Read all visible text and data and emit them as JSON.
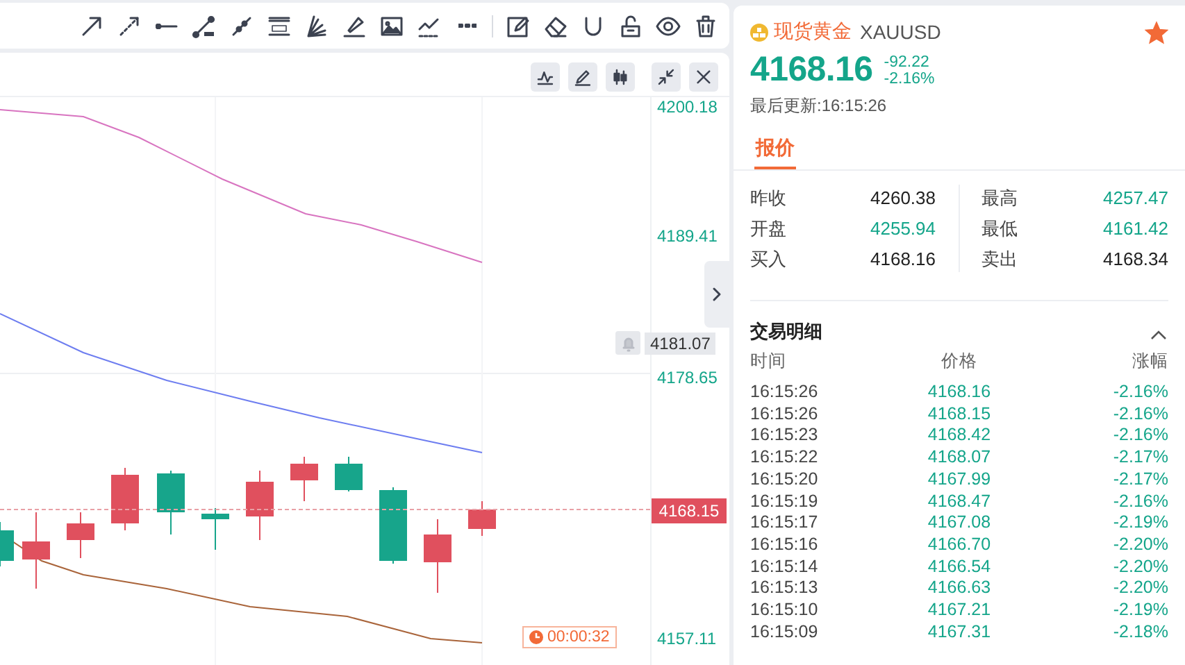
{
  "chart": {
    "header_buttons": [
      {
        "kind": "indicator"
      },
      {
        "kind": "draw"
      },
      {
        "kind": "candles"
      },
      {
        "kind": "shrink"
      },
      {
        "kind": "close"
      }
    ],
    "price_ticks": [
      "4200.18",
      "4189.41",
      "4178.65",
      "4157.11"
    ],
    "alert_price": "4181.07",
    "last_price": "4168.15",
    "countdown": "00:00:32"
  },
  "quote": {
    "name": "现货黄金",
    "symbol": "XAUUSD",
    "favorite": true,
    "price": "4168.16",
    "change": "-92.22",
    "change_pct": "-2.16%",
    "updated": "最后更新:16:15:26",
    "tabs": [
      {
        "label": "报价",
        "selected": true
      }
    ],
    "stats": [
      {
        "label": "昨收",
        "value": "4260.38",
        "color": "#222222"
      },
      {
        "label": "最高",
        "value": "4257.47",
        "color": "#14a58a"
      },
      {
        "label": "开盘",
        "value": "4255.94",
        "color": "#14a58a"
      },
      {
        "label": "最低",
        "value": "4161.42",
        "color": "#14a58a"
      },
      {
        "label": "买入",
        "value": "4168.16",
        "color": "#222222"
      },
      {
        "label": "卖出",
        "value": "4168.34",
        "color": "#222222"
      }
    ]
  },
  "trades": {
    "title": "交易明细",
    "expanded": true,
    "columns": [
      "时间",
      "价格",
      "涨幅"
    ],
    "rows": [
      {
        "time": "16:15:26",
        "price": "4168.16",
        "change": "-2.16%"
      },
      {
        "time": "16:15:26",
        "price": "4168.15",
        "change": "-2.16%"
      },
      {
        "time": "16:15:23",
        "price": "4168.42",
        "change": "-2.16%"
      },
      {
        "time": "16:15:22",
        "price": "4168.07",
        "change": "-2.17%"
      },
      {
        "time": "16:15:20",
        "price": "4167.99",
        "change": "-2.17%"
      },
      {
        "time": "16:15:19",
        "price": "4168.47",
        "change": "-2.16%"
      },
      {
        "time": "16:15:17",
        "price": "4167.08",
        "change": "-2.19%"
      },
      {
        "time": "16:15:16",
        "price": "4166.70",
        "change": "-2.20%"
      },
      {
        "time": "16:15:14",
        "price": "4166.54",
        "change": "-2.20%"
      },
      {
        "time": "16:15:13",
        "price": "4166.63",
        "change": "-2.20%"
      },
      {
        "time": "16:15:10",
        "price": "4167.21",
        "change": "-2.19%"
      },
      {
        "time": "16:15:09",
        "price": "4167.31",
        "change": "-2.18%"
      }
    ]
  }
}
